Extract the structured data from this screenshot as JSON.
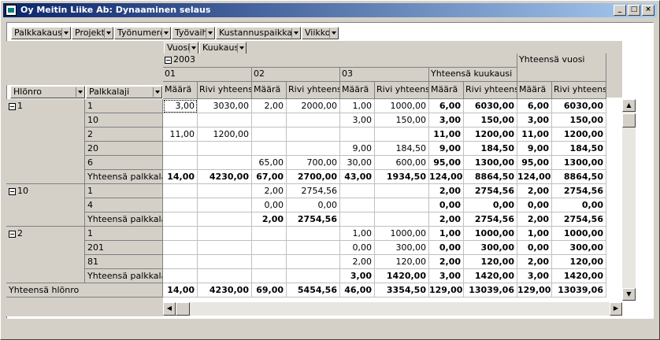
{
  "window": {
    "title": "Oy Meitin Liike Ab: Dynaaminen selaus"
  },
  "page_fields": [
    "Palkkakausi",
    "Projekti",
    "Työnumero",
    "Työvaihe",
    "Kustannuspaikka",
    "Viikko"
  ],
  "col_fields": [
    "Vuosi",
    "Kuukausi"
  ],
  "row_fields": [
    "Hlönro",
    "Palkkalaji"
  ],
  "year": "2003",
  "year_total": "Yhteensä vuosi",
  "months": [
    "01",
    "02",
    "03"
  ],
  "month_total": "Yhteensä kuukausi",
  "measures": [
    "Määrä",
    "Rivi yhteensä"
  ],
  "groups": [
    {
      "id": "1",
      "rows": [
        {
          "label": "1",
          "v": [
            "3,00",
            "3030,00",
            "2,00",
            "2000,00",
            "1,00",
            "1000,00",
            "6,00",
            "6030,00",
            "6,00",
            "6030,00"
          ]
        },
        {
          "label": "10",
          "v": [
            "",
            "",
            "",
            "",
            "3,00",
            "150,00",
            "3,00",
            "150,00",
            "3,00",
            "150,00"
          ]
        },
        {
          "label": "2",
          "v": [
            "11,00",
            "1200,00",
            "",
            "",
            "",
            "",
            "11,00",
            "1200,00",
            "11,00",
            "1200,00"
          ]
        },
        {
          "label": "20",
          "v": [
            "",
            "",
            "",
            "",
            "9,00",
            "184,50",
            "9,00",
            "184,50",
            "9,00",
            "184,50"
          ]
        },
        {
          "label": "6",
          "v": [
            "",
            "",
            "65,00",
            "700,00",
            "30,00",
            "600,00",
            "95,00",
            "1300,00",
            "95,00",
            "1300,00"
          ]
        },
        {
          "label": "Yhteensä palkkalaji",
          "total": true,
          "v": [
            "14,00",
            "4230,00",
            "67,00",
            "2700,00",
            "43,00",
            "1934,50",
            "124,00",
            "8864,50",
            "124,00",
            "8864,50"
          ]
        }
      ]
    },
    {
      "id": "10",
      "rows": [
        {
          "label": "1",
          "v": [
            "",
            "",
            "2,00",
            "2754,56",
            "",
            "",
            "2,00",
            "2754,56",
            "2,00",
            "2754,56"
          ]
        },
        {
          "label": "4",
          "v": [
            "",
            "",
            "0,00",
            "0,00",
            "",
            "",
            "0,00",
            "0,00",
            "0,00",
            "0,00"
          ]
        },
        {
          "label": "Yhteensä palkkalaji",
          "total": true,
          "v": [
            "",
            "",
            "2,00",
            "2754,56",
            "",
            "",
            "2,00",
            "2754,56",
            "2,00",
            "2754,56"
          ]
        }
      ]
    },
    {
      "id": "2",
      "rows": [
        {
          "label": "1",
          "v": [
            "",
            "",
            "",
            "",
            "1,00",
            "1000,00",
            "1,00",
            "1000,00",
            "1,00",
            "1000,00"
          ]
        },
        {
          "label": "201",
          "v": [
            "",
            "",
            "",
            "",
            "0,00",
            "300,00",
            "0,00",
            "300,00",
            "0,00",
            "300,00"
          ]
        },
        {
          "label": "81",
          "v": [
            "",
            "",
            "",
            "",
            "2,00",
            "120,00",
            "2,00",
            "120,00",
            "2,00",
            "120,00"
          ]
        },
        {
          "label": "Yhteensä palkkalaji",
          "total": true,
          "v": [
            "",
            "",
            "",
            "",
            "3,00",
            "1420,00",
            "3,00",
            "1420,00",
            "3,00",
            "1420,00"
          ]
        }
      ]
    }
  ],
  "grand_total": {
    "label": "Yhteensä hlönro",
    "v": [
      "14,00",
      "4230,00",
      "69,00",
      "5454,56",
      "46,00",
      "3354,50",
      "129,00",
      "13039,06",
      "129,00",
      "13039,06"
    ]
  }
}
